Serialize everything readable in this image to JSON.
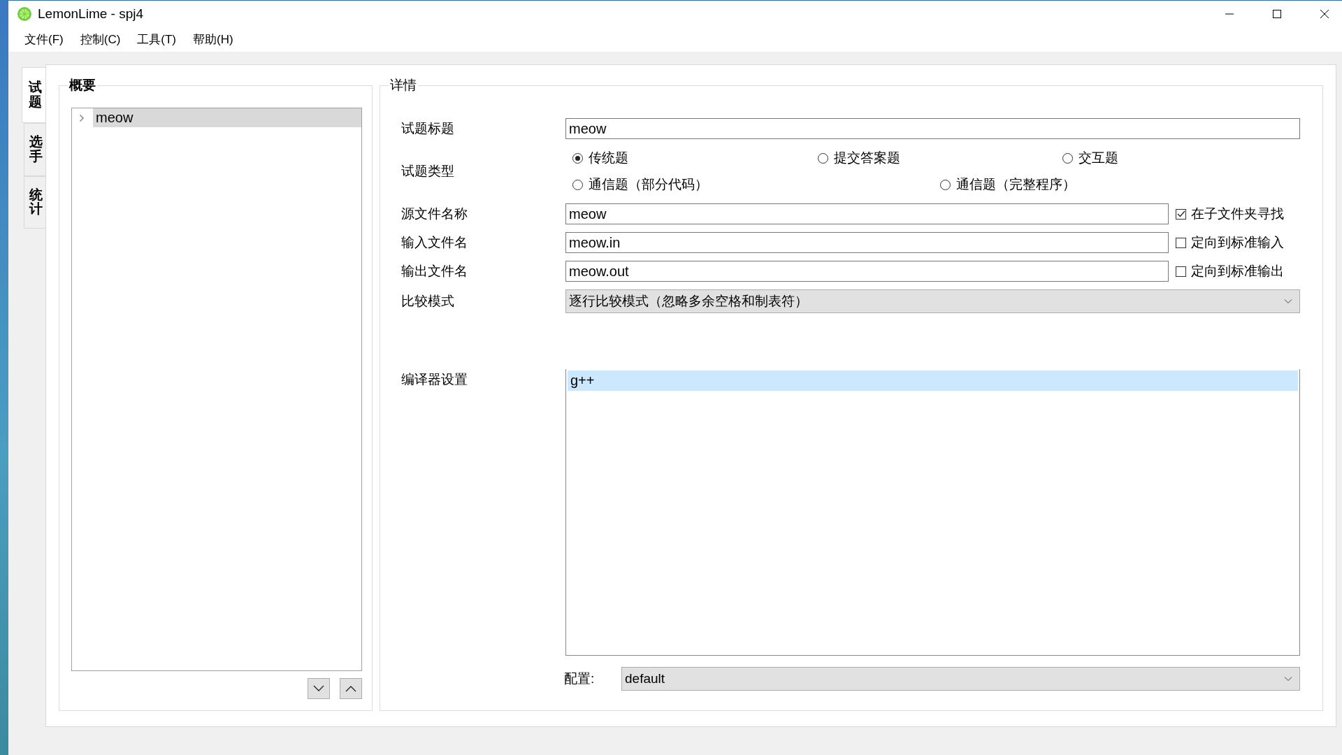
{
  "window": {
    "title": "LemonLime - spj4"
  },
  "menu": [
    "文件(F)",
    "控制(C)",
    "工具(T)",
    "帮助(H)"
  ],
  "side_tabs": [
    {
      "label": "试题",
      "selected": true
    },
    {
      "label": "选手",
      "selected": false
    },
    {
      "label": "统计",
      "selected": false
    }
  ],
  "summary": {
    "title": "概要",
    "tree": [
      {
        "label": "meow",
        "selected": true,
        "expanded": false
      }
    ]
  },
  "details": {
    "title": "详情",
    "problem_title": {
      "label": "试题标题",
      "value": "meow"
    },
    "problem_type": {
      "label": "试题类型",
      "options": [
        {
          "label": "传统题",
          "selected": true
        },
        {
          "label": "提交答案题",
          "selected": false
        },
        {
          "label": "交互题",
          "selected": false
        },
        {
          "label": "通信题（部分代码）",
          "selected": false
        },
        {
          "label": "通信题（完整程序）",
          "selected": false
        }
      ]
    },
    "file_rows": [
      {
        "label": "源文件名称",
        "value": "meow",
        "checkbox": {
          "label": "在子文件夹寻找",
          "checked": true
        }
      },
      {
        "label": "输入文件名",
        "value": "meow.in",
        "checkbox": {
          "label": "定向到标准输入",
          "checked": false
        }
      },
      {
        "label": "输出文件名",
        "value": "meow.out",
        "checkbox": {
          "label": "定向到标准输出",
          "checked": false
        }
      }
    ],
    "compare_mode": {
      "label": "比较模式",
      "value": "逐行比较模式（忽略多余空格和制表符）"
    },
    "compiler": {
      "label": "编译器设置",
      "items": [
        {
          "label": "g++",
          "selected": true
        }
      ]
    },
    "config": {
      "label": "配置:",
      "value": "default"
    }
  }
}
